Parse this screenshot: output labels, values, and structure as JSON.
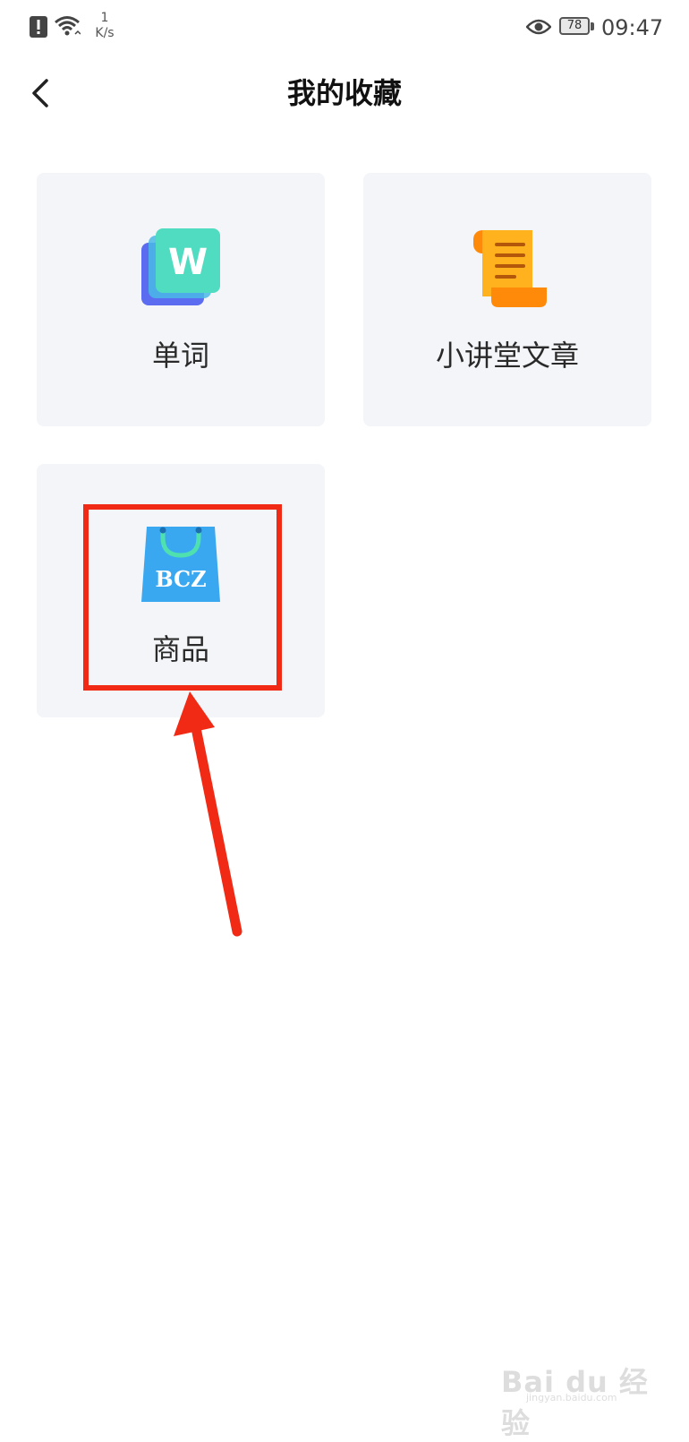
{
  "status_bar": {
    "speed_value": "1",
    "speed_unit": "K/s",
    "battery": "78",
    "time": "09:47",
    "icons": [
      "alert-icon",
      "wifi-icon",
      "eye-icon",
      "battery-icon"
    ]
  },
  "header": {
    "title": "我的收藏",
    "back_icon": "chevron-left-icon"
  },
  "cards": [
    {
      "label": "单词",
      "icon": "word-book-icon",
      "icon_text": "W",
      "colors": {
        "front": "#4fdcc0",
        "back": "#5b6cf0"
      }
    },
    {
      "label": "小讲堂文章",
      "icon": "scroll-icon",
      "colors": {
        "body": "#ffb21e",
        "curl": "#ff8a0a",
        "lines": "#b3570a"
      }
    },
    {
      "label": "商品",
      "icon": "shopping-bag-icon",
      "icon_text": "BCZ",
      "colors": {
        "bag": "#3aa8f0",
        "handle": "#4fe0b0"
      }
    }
  ],
  "annotation": {
    "box_color": "#f02a14",
    "arrow_color": "#f02a14"
  },
  "watermark": {
    "text": "Bai du 经验",
    "sub": "jingyan.baidu.com"
  }
}
